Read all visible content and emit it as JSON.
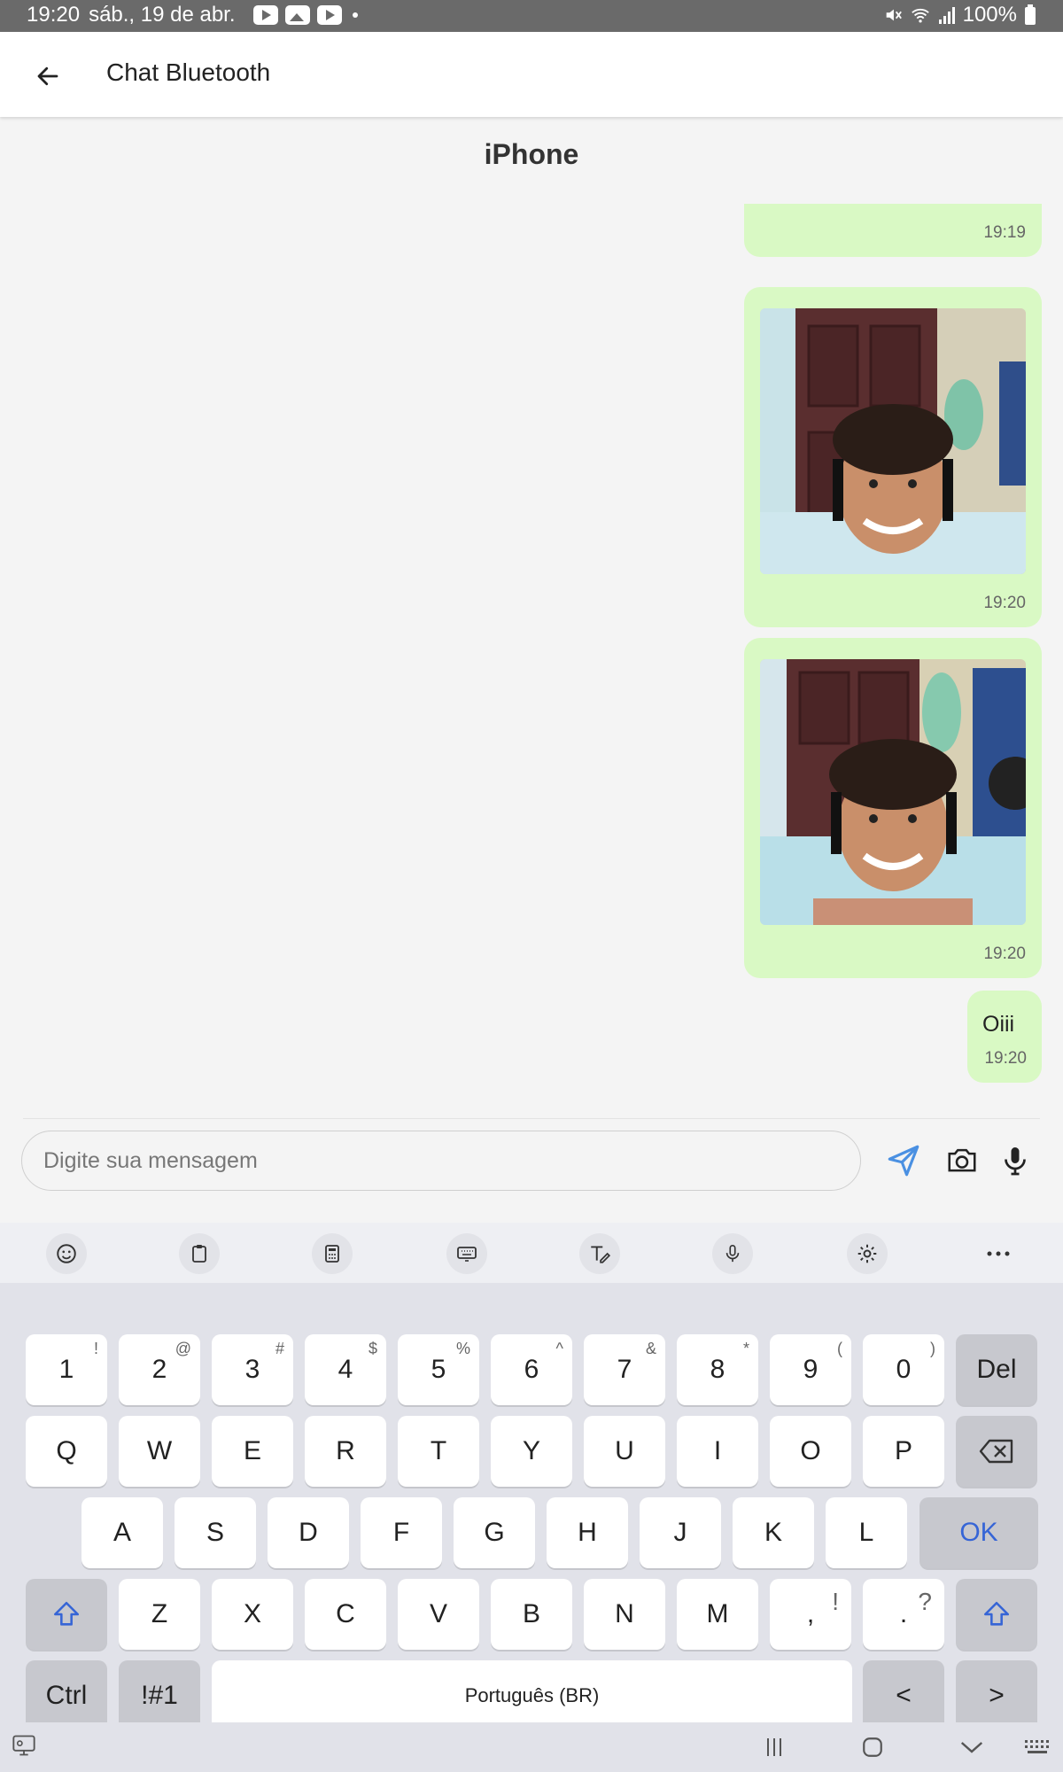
{
  "status_bar": {
    "time": "19:20",
    "date": "sáb., 19 de abr.",
    "battery": "100%"
  },
  "app_bar": {
    "title": "Chat Bluetooth"
  },
  "device_name": "iPhone",
  "messages": [
    {
      "type": "image",
      "time": "19:19"
    },
    {
      "type": "image",
      "time": "19:20"
    },
    {
      "type": "image",
      "time": "19:20"
    },
    {
      "type": "text",
      "text": "Oiii",
      "time": "19:20"
    }
  ],
  "composer": {
    "placeholder": "Digite sua mensagem"
  },
  "icons": {
    "back": "arrow-left-icon",
    "send": "send-icon",
    "camera": "camera-icon",
    "mic": "microphone-icon"
  },
  "keyboard": {
    "toolbar": [
      "emoji-icon",
      "clipboard-icon",
      "keypad-icon",
      "keyboard-icon",
      "handwriting-icon",
      "voice-input-icon",
      "settings-icon",
      "more-icon"
    ],
    "row1": [
      {
        "k": "1",
        "s": "!"
      },
      {
        "k": "2",
        "s": "@"
      },
      {
        "k": "3",
        "s": "#"
      },
      {
        "k": "4",
        "s": "$"
      },
      {
        "k": "5",
        "s": "%"
      },
      {
        "k": "6",
        "s": "^"
      },
      {
        "k": "7",
        "s": "&"
      },
      {
        "k": "8",
        "s": "*"
      },
      {
        "k": "9",
        "s": "("
      },
      {
        "k": "0",
        "s": ")"
      }
    ],
    "del_label": "Del",
    "row2": [
      "Q",
      "W",
      "E",
      "R",
      "T",
      "Y",
      "U",
      "I",
      "O",
      "P"
    ],
    "row3": [
      "A",
      "S",
      "D",
      "F",
      "G",
      "H",
      "J",
      "K",
      "L"
    ],
    "ok_label": "OK",
    "row4": [
      "Z",
      "X",
      "C",
      "V",
      "B",
      "N",
      "M"
    ],
    "comma": {
      "k": ",",
      "s": "!"
    },
    "period": {
      "k": ".",
      "s": "?"
    },
    "ctrl_label": "Ctrl",
    "symbols_label": "!#1",
    "space_label": "Português (BR)",
    "left_label": "<",
    "right_label": ">"
  },
  "colors": {
    "bubble": "#d9f9c4",
    "accent": "#3665d6",
    "send": "#4a90e2"
  }
}
